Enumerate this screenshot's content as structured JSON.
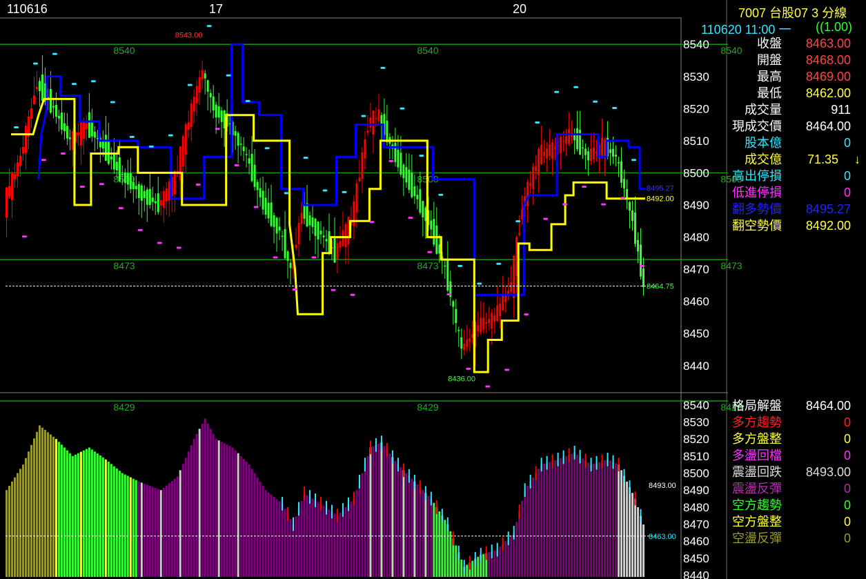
{
  "header": {
    "dates": [
      "110616",
      "17",
      "20"
    ],
    "symbol_title": "7007  台股07 3 分線",
    "time_line": "110620 11:00 一",
    "ratio": "((1.00)"
  },
  "colors": {
    "background": "#000000",
    "up_bar": "#ff0000",
    "down_bar": "#33ff33",
    "long_line": "#0000ff",
    "short_line": "#ffff00",
    "marker_cyan": "#33e6ff",
    "marker_magenta": "#ff33ff",
    "ref_line": "#119911",
    "purple_bar": "#800080",
    "olive_bar": "#999933",
    "gray_bar": "#cccccc"
  },
  "quote": [
    {
      "label": "收盤",
      "value": "8463.00",
      "label_color": "#ffffff",
      "value_color": "#ff4444"
    },
    {
      "label": "開盤",
      "value": "8468.00",
      "label_color": "#ffffff",
      "value_color": "#ff4444"
    },
    {
      "label": "最高",
      "value": "8469.00",
      "label_color": "#ffffff",
      "value_color": "#ff4444"
    },
    {
      "label": "最低",
      "value": "8462.00",
      "label_color": "#ffffff",
      "value_color": "#ffff44"
    },
    {
      "label": "成交量",
      "value": "911",
      "label_color": "#ffffff",
      "value_color": "#ffffff"
    },
    {
      "label": "現成交價",
      "value": "8464.00",
      "label_color": "#ffffff",
      "value_color": "#ffffff"
    },
    {
      "label": "股本億",
      "value": "0",
      "label_color": "#33e6ff",
      "value_color": "#33e6ff"
    },
    {
      "label": "成交億",
      "value": "71.35",
      "arrow": "↓",
      "label_color": "#ffff44",
      "value_color": "#ffff44"
    },
    {
      "label": "高出停損",
      "value": "0",
      "label_color": "#33e6ff",
      "value_color": "#33e6ff"
    },
    {
      "label": "低進停損",
      "value": "0",
      "label_color": "#ff33ff",
      "value_color": "#ff33ff"
    },
    {
      "label": "翻多勢價",
      "value": "8495.27",
      "label_color": "#2222ff",
      "value_color": "#2222ff"
    },
    {
      "label": "翻空勢價",
      "value": "8492.00",
      "label_color": "#ffff44",
      "value_color": "#ffff44"
    }
  ],
  "pattern": [
    {
      "label": "格局解盤",
      "value": "8464.00",
      "label_color": "#ffffff",
      "value_color": "#ffffff"
    },
    {
      "label": "多方趨勢",
      "value": "0",
      "label_color": "#ff2222",
      "value_color": "#ff2222"
    },
    {
      "label": "多方盤整",
      "value": "0",
      "label_color": "#ffff44",
      "value_color": "#ffff44"
    },
    {
      "label": "多盪回檔",
      "value": "0",
      "label_color": "#ff33ff",
      "value_color": "#ff33ff"
    },
    {
      "label": "震盪回跌",
      "value": "8493.00",
      "label_color": "#dddddd",
      "value_color": "#dddddd"
    },
    {
      "label": "震盪反彈",
      "value": "0",
      "label_color": "#aa33aa",
      "value_color": "#aa33aa"
    },
    {
      "label": "空方趨勢",
      "value": "0",
      "label_color": "#33ff33",
      "value_color": "#33ff33"
    },
    {
      "label": "空方盤整",
      "value": "0",
      "label_color": "#ffff44",
      "value_color": "#ffff44"
    },
    {
      "label": "空盪反彈",
      "value": "0",
      "label_color": "#999933",
      "value_color": "#999933"
    }
  ],
  "chart_data": [
    {
      "type": "candlestick",
      "ylim": [
        8432,
        8548
      ],
      "yticks": [
        8540,
        8530,
        8520,
        8510,
        8500,
        8490,
        8480,
        8470,
        8460,
        8450,
        8440
      ],
      "reference_lines": [
        {
          "value": 8540,
          "label": "8540"
        },
        {
          "value": 8500,
          "label": "8500"
        },
        {
          "value": 8473,
          "label": "8473"
        },
        {
          "value": 8429,
          "label": "8429"
        }
      ],
      "annotations": [
        {
          "text": "8543.00",
          "x": 67,
          "y": 8543,
          "color": "#ff3333"
        },
        {
          "text": "8436.00",
          "x": 166,
          "y": 8436,
          "color": "#33ff33"
        },
        {
          "text": "8495.27",
          "x": 232,
          "y": 8495.27,
          "color": "#3333ff"
        },
        {
          "text": "8492.00",
          "x": 232,
          "y": 8492,
          "color": "#ffff44"
        },
        {
          "text": "8464.75",
          "x": 232,
          "y": 8464.75,
          "color": "#33ff33"
        }
      ],
      "last_price": 8464.75,
      "bar_count": 232,
      "series": [
        {
          "name": "翻多勢價",
          "color": "#0000ff",
          "points": [
            [
              12,
              8498
            ],
            [
              13,
              8512
            ],
            [
              15,
              8520
            ],
            [
              15,
              8530
            ],
            [
              20,
              8530
            ],
            [
              20,
              8524
            ],
            [
              27,
              8524
            ],
            [
              27,
              8516
            ],
            [
              34,
              8516
            ],
            [
              34,
              8510
            ],
            [
              48,
              8510
            ],
            [
              48,
              8508
            ],
            [
              60,
              8508
            ],
            [
              60,
              8492
            ],
            [
              72,
              8492
            ],
            [
              72,
              8505
            ],
            [
              82,
              8505
            ],
            [
              82,
              8540
            ],
            [
              86,
              8540
            ],
            [
              86,
              8522
            ],
            [
              92,
              8522
            ],
            [
              92,
              8518
            ],
            [
              100,
              8518
            ],
            [
              100,
              8495
            ],
            [
              108,
              8495
            ],
            [
              108,
              8490
            ],
            [
              120,
              8490
            ],
            [
              120,
              8505
            ],
            [
              127,
              8505
            ],
            [
              127,
              8515
            ],
            [
              137,
              8515
            ],
            [
              137,
              8508
            ],
            [
              155,
              8508
            ],
            [
              155,
              8498
            ],
            [
              170,
              8498
            ],
            [
              170,
              8462
            ],
            [
              188,
              8462
            ],
            [
              188,
              8490
            ],
            [
              190,
              8493
            ],
            [
              200,
              8493
            ],
            [
              200,
              8512
            ],
            [
              215,
              8512
            ],
            [
              215,
              8505
            ],
            [
              218,
              8505
            ],
            [
              218,
              8510
            ],
            [
              226,
              8510
            ],
            [
              226,
              8508
            ],
            [
              230,
              8508
            ],
            [
              230,
              8495
            ],
            [
              232,
              8495
            ]
          ]
        },
        {
          "name": "翻空勢價",
          "color": "#ffff00",
          "points": [
            [
              2,
              8512
            ],
            [
              10,
              8512
            ],
            [
              12,
              8518
            ],
            [
              14,
              8523
            ],
            [
              25,
              8523
            ],
            [
              25,
              8490
            ],
            [
              31,
              8490
            ],
            [
              31,
              8506
            ],
            [
              41,
              8506
            ],
            [
              41,
              8508
            ],
            [
              48,
              8508
            ],
            [
              48,
              8500
            ],
            [
              64,
              8500
            ],
            [
              64,
              8490
            ],
            [
              80,
              8490
            ],
            [
              80,
              8518
            ],
            [
              90,
              8518
            ],
            [
              90,
              8510
            ],
            [
              103,
              8510
            ],
            [
              103,
              8484
            ],
            [
              105,
              8470
            ],
            [
              106,
              8456
            ],
            [
              115,
              8456
            ],
            [
              115,
              8475
            ],
            [
              118,
              8475
            ],
            [
              118,
              8480
            ],
            [
              125,
              8480
            ],
            [
              125,
              8485
            ],
            [
              132,
              8485
            ],
            [
              132,
              8495
            ],
            [
              136,
              8495
            ],
            [
              136,
              8510
            ],
            [
              153,
              8510
            ],
            [
              153,
              8480
            ],
            [
              158,
              8480
            ],
            [
              158,
              8473
            ],
            [
              170,
              8473
            ],
            [
              170,
              8438
            ],
            [
              175,
              8438
            ],
            [
              175,
              8448
            ],
            [
              180,
              8448
            ],
            [
              180,
              8454
            ],
            [
              186,
              8454
            ],
            [
              186,
              8478
            ],
            [
              190,
              8478
            ],
            [
              190,
              8476
            ],
            [
              198,
              8476
            ],
            [
              198,
              8484
            ],
            [
              203,
              8484
            ],
            [
              203,
              8493
            ],
            [
              206,
              8493
            ],
            [
              206,
              8497
            ],
            [
              218,
              8497
            ],
            [
              218,
              8492
            ],
            [
              232,
              8492
            ]
          ]
        }
      ]
    },
    {
      "type": "bar",
      "ylim": [
        8439,
        8546
      ],
      "yticks": [
        8540,
        8530,
        8520,
        8510,
        8500,
        8490,
        8480,
        8470,
        8460,
        8450,
        8440
      ],
      "annotations": [
        {
          "text": "8493.00",
          "x": 232,
          "y": 8493,
          "color": "#ffffff"
        },
        {
          "text": "8463.00",
          "x": 232,
          "y": 8463,
          "color": "#33e6ff"
        }
      ],
      "series": [
        {
          "name": "close",
          "segments": [
            [
              0,
              8496,
              8500
            ],
            [
              20,
              8498,
              8535
            ],
            [
              50,
              8496,
              8490
            ],
            [
              75,
              8510,
              8540
            ],
            [
              90,
              8520,
              8510
            ],
            [
              110,
              8490,
              8490
            ],
            [
              130,
              8520,
              8525
            ],
            [
              150,
              8480,
              8470
            ],
            [
              175,
              8466,
              8463
            ],
            [
              183,
              8500,
              8490
            ],
            [
              200,
              8510,
              8500
            ],
            [
              210,
              8510,
              8505
            ],
            [
              225,
              8500,
              8490
            ],
            [
              232,
              8493,
              8490
            ]
          ]
        }
      ]
    }
  ]
}
